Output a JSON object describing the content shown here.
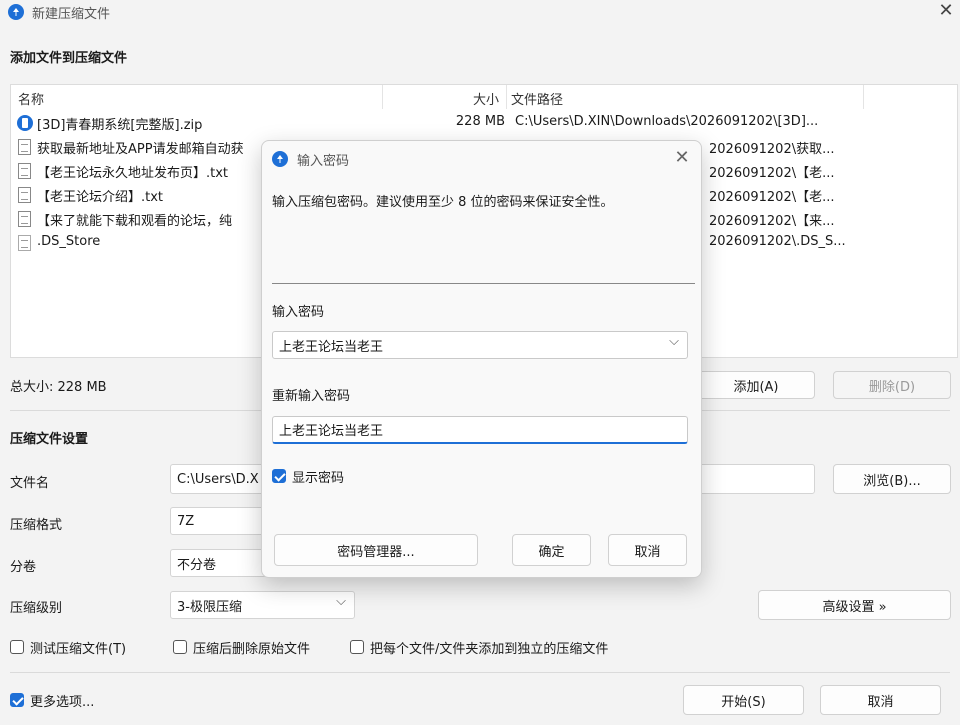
{
  "window": {
    "title": "新建压缩文件",
    "close_glyph": "✕"
  },
  "files_section": {
    "title": "添加文件到压缩文件",
    "columns": {
      "name": "名称",
      "size": "大小",
      "path": "文件路径"
    },
    "rows": [
      {
        "icon": "zip-archive-icon",
        "name": "[3D]青春期系统[完整版].zip",
        "size": "228 MB",
        "path": "C:\\Users\\D.XIN\\Downloads\\2026091202\\[3D]..."
      },
      {
        "icon": "text-file-icon",
        "name": "获取最新地址及APP请发邮箱自动获",
        "size": "",
        "path": "2026091202\\获取..."
      },
      {
        "icon": "text-file-icon",
        "name": "【老王论坛永久地址发布页】.txt",
        "size": "",
        "path": "2026091202\\【老..."
      },
      {
        "icon": "text-file-icon",
        "name": "【老王论坛介绍】.txt",
        "size": "",
        "path": "2026091202\\【老..."
      },
      {
        "icon": "text-file-icon",
        "name": "【来了就能下载和观看的论坛，纯",
        "size": "",
        "path": "2026091202\\【来..."
      },
      {
        "icon": "blank-file-icon",
        "name": ".DS_Store",
        "size": "",
        "path": "2026091202\\.DS_S..."
      }
    ],
    "total_size": "总大小: 228 MB",
    "add_button": "添加(A)",
    "delete_button": "删除(D)"
  },
  "settings": {
    "title": "压缩文件设置",
    "filename_label": "文件名",
    "filename_value": "C:\\Users\\D.X",
    "browse_button": "浏览(B)...",
    "format_label": "压缩格式",
    "format_value": "7Z",
    "volume_label": "分卷",
    "volume_value": "不分卷",
    "level_label": "压缩级别",
    "level_value": "3-极限压缩",
    "advanced_button": "高级设置 »",
    "test_archive": {
      "label": "测试压缩文件(T)",
      "checked": false
    },
    "delete_after": {
      "label": "压缩后删除原始文件",
      "checked": false
    },
    "separate_archives": {
      "label": "把每个文件/文件夹添加到独立的压缩文件",
      "checked": false
    }
  },
  "footer": {
    "more_options": {
      "label": "更多选项...",
      "checked": true
    },
    "start_button": "开始(S)",
    "cancel_button": "取消"
  },
  "password_dialog": {
    "title": "输入密码",
    "close_glyph": "✕",
    "description": "输入压缩包密码。建议使用至少 8 位的密码来保证安全性。",
    "password_label": "输入密码",
    "password_value": "上老王论坛当老王",
    "confirm_label": "重新输入密码",
    "confirm_value": "上老王论坛当老王",
    "show_password": {
      "label": "显示密码",
      "checked": true
    },
    "manager_button": "密码管理器...",
    "ok_button": "确定",
    "cancel_button": "取消"
  },
  "colors": {
    "accent": "#1e6fd6",
    "background": "#f3f3f3"
  }
}
